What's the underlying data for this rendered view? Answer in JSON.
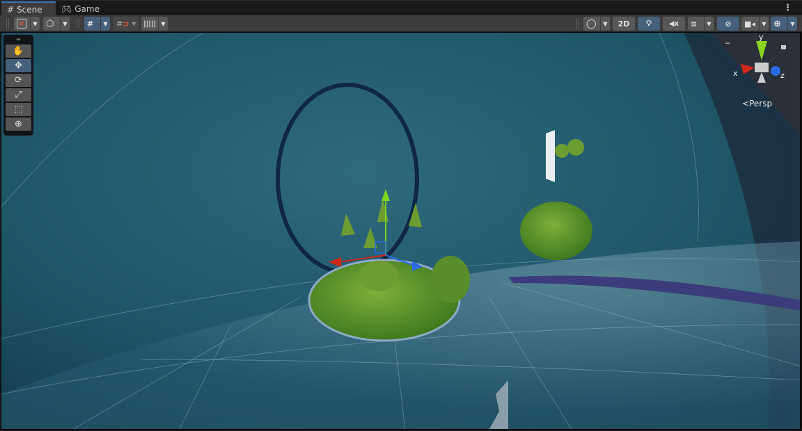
{
  "tabs": [
    {
      "label": "Scene",
      "icon": "grid-icon",
      "active": true
    },
    {
      "label": "Game",
      "icon": "gamepad-icon",
      "active": false
    }
  ],
  "toolbar": {
    "left": [
      {
        "name": "draw-mode",
        "icon": "gizmo-draw-icon",
        "dropdown": true,
        "active": false
      },
      {
        "name": "render-mode",
        "icon": "cube-icon",
        "dropdown": true,
        "active": false
      },
      {
        "name": "grid-snapping",
        "icon": "grid-snap-icon",
        "dropdown": true,
        "active": true
      },
      {
        "name": "incremental-snap",
        "icon": "snap-magnet-icon",
        "dropdown": true,
        "active": false
      },
      {
        "name": "ruler",
        "icon": "ruler-icon",
        "dropdown": true,
        "active": false
      }
    ],
    "right": {
      "shading_icon": "shading-icon",
      "mode_2d": "2D",
      "lighting_icon": "bulb-icon",
      "audio_icon": "audio-mute-icon",
      "effects_icon": "effects-icon",
      "hidden_icon": "eye-hidden-icon",
      "camera_icon": "camera-icon",
      "gizmos_icon": "gizmos-icon"
    }
  },
  "tools": [
    {
      "name": "hand",
      "icon": "✋"
    },
    {
      "name": "move",
      "icon": "✥",
      "active": true
    },
    {
      "name": "rotate",
      "icon": "⟳"
    },
    {
      "name": "scale",
      "icon": "⤢"
    },
    {
      "name": "rect",
      "icon": "⬚"
    },
    {
      "name": "transform",
      "icon": "⊕"
    }
  ],
  "gizmo": {
    "x": "x",
    "y": "y",
    "z": "z",
    "projection": "Persp",
    "lock_icon": "lock-icon"
  },
  "colors": {
    "accent": "#46607c",
    "x_axis": "#d0281b",
    "y_axis": "#8ad21e",
    "z_axis": "#2a6be0"
  }
}
